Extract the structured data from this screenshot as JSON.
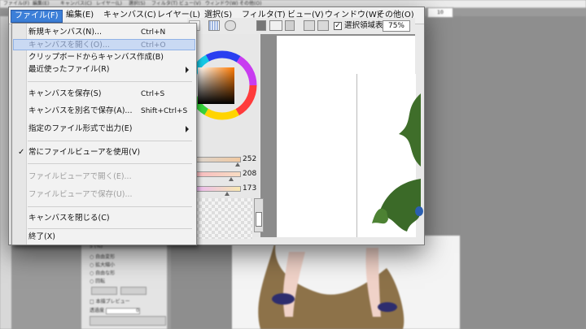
{
  "background_app": {
    "menu": [
      "ファイル(F)",
      "編集(E)",
      "キャンバス(C)",
      "レイヤー(L)",
      "選択(S)",
      "フィルタ(T)",
      "ビュー(V)",
      "ウィンドウ(W)",
      "その他(O)"
    ],
    "zoom_value": "10",
    "panel_rows": [
      "5 (%)",
      "自由変形",
      "拡大縮小",
      "自由な形",
      "回転",
      "本描プレビュー",
      "透過度"
    ],
    "transparency_value": "0"
  },
  "menubar": {
    "items": [
      "ファイル(F)",
      "編集(E)",
      "キャンバス(C)",
      "レイヤー(L)",
      "選択(S)",
      "フィルタ(T)",
      "ビュー(V)",
      "ウィンドウ(W)",
      "その他(O)"
    ],
    "active_index": 0
  },
  "toolbar": {
    "show_selection_label": "選択領域表示",
    "show_selection_checked": true,
    "zoom": "75%"
  },
  "color": {
    "values": [
      252,
      208,
      173
    ]
  },
  "file_menu": {
    "items": [
      {
        "label": "新規キャンバス(N)...",
        "shortcut": "Ctrl+N",
        "state": "normal"
      },
      {
        "label": "キャンバスを開く(O)...",
        "shortcut": "Ctrl+O",
        "state": "highlighted"
      },
      {
        "label": "クリップボードからキャンバス作成(B)",
        "shortcut": "",
        "state": "normal"
      },
      {
        "label": "最近使ったファイル(R)",
        "shortcut": "",
        "state": "submenu"
      },
      {
        "label": "キャンバスを保存(S)",
        "shortcut": "Ctrl+S",
        "state": "normal"
      },
      {
        "label": "キャンバスを別名で保存(A)...",
        "shortcut": "Shift+Ctrl+S",
        "state": "normal"
      },
      {
        "label": "指定のファイル形式で出力(E)",
        "shortcut": "",
        "state": "submenu"
      },
      {
        "label": "常にファイルビューアを使用(V)",
        "shortcut": "",
        "state": "checked"
      },
      {
        "label": "ファイルビューアで開く(E)...",
        "shortcut": "",
        "state": "disabled"
      },
      {
        "label": "ファイルビューアで保存(U)...",
        "shortcut": "",
        "state": "disabled"
      },
      {
        "label": "キャンバスを閉じる(C)",
        "shortcut": "",
        "state": "normal"
      },
      {
        "label": "終了(X)",
        "shortcut": "",
        "state": "normal"
      }
    ]
  }
}
